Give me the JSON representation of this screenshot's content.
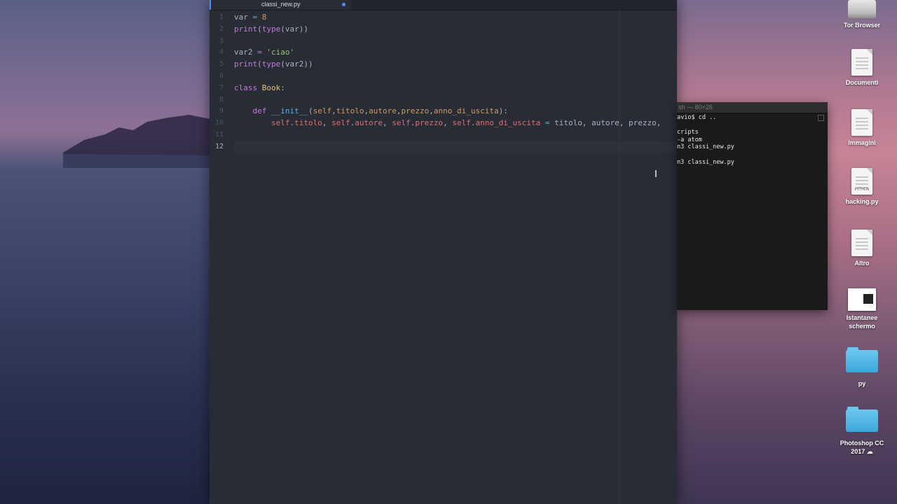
{
  "editor": {
    "tab_title": "classi_new.py",
    "line_numbers": [
      "1",
      "2",
      "3",
      "4",
      "5",
      "6",
      "7",
      "8",
      "9",
      "10",
      "11",
      "12"
    ],
    "lines": [
      [
        {
          "t": "var ",
          "c": ""
        },
        {
          "t": "=",
          "c": "op"
        },
        {
          "t": " ",
          "c": ""
        },
        {
          "t": "8",
          "c": "num"
        }
      ],
      [
        {
          "t": "print",
          "c": "kw"
        },
        {
          "t": "(",
          "c": ""
        },
        {
          "t": "type",
          "c": "kw"
        },
        {
          "t": "(var))",
          "c": ""
        }
      ],
      [],
      [
        {
          "t": "var2 ",
          "c": ""
        },
        {
          "t": "=",
          "c": "op"
        },
        {
          "t": " ",
          "c": ""
        },
        {
          "t": "'ciao'",
          "c": "str"
        }
      ],
      [
        {
          "t": "print",
          "c": "kw"
        },
        {
          "t": "(",
          "c": ""
        },
        {
          "t": "type",
          "c": "kw"
        },
        {
          "t": "(var2))",
          "c": ""
        }
      ],
      [],
      [
        {
          "t": "class",
          "c": "kw"
        },
        {
          "t": " ",
          "c": ""
        },
        {
          "t": "Book",
          "c": "cls"
        },
        {
          "t": ":",
          "c": ""
        }
      ],
      [],
      [
        {
          "t": "    ",
          "c": ""
        },
        {
          "t": "def",
          "c": "kw"
        },
        {
          "t": " ",
          "c": ""
        },
        {
          "t": "__init__",
          "c": "fn"
        },
        {
          "t": "(",
          "c": ""
        },
        {
          "t": "self",
          "c": "prm"
        },
        {
          "t": ",",
          "c": ""
        },
        {
          "t": "titolo",
          "c": "prm"
        },
        {
          "t": ",",
          "c": ""
        },
        {
          "t": "autore",
          "c": "prm"
        },
        {
          "t": ",",
          "c": ""
        },
        {
          "t": "prezzo",
          "c": "prm"
        },
        {
          "t": ",",
          "c": ""
        },
        {
          "t": "anno_di_uscita",
          "c": "prm"
        },
        {
          "t": "):",
          "c": ""
        }
      ],
      [
        {
          "t": "        ",
          "c": ""
        },
        {
          "t": "self",
          "c": "self"
        },
        {
          "t": ".",
          "c": ""
        },
        {
          "t": "titolo",
          "c": "self"
        },
        {
          "t": ", ",
          "c": ""
        },
        {
          "t": "self",
          "c": "self"
        },
        {
          "t": ".",
          "c": ""
        },
        {
          "t": "autore",
          "c": "self"
        },
        {
          "t": ", ",
          "c": ""
        },
        {
          "t": "self",
          "c": "self"
        },
        {
          "t": ".",
          "c": ""
        },
        {
          "t": "prezzo",
          "c": "self"
        },
        {
          "t": ", ",
          "c": ""
        },
        {
          "t": "self",
          "c": "self"
        },
        {
          "t": ".",
          "c": ""
        },
        {
          "t": "anno_di_uscita",
          "c": "self"
        },
        {
          "t": " ",
          "c": ""
        },
        {
          "t": "=",
          "c": "op"
        },
        {
          "t": " titolo, autore, prezzo,",
          "c": ""
        }
      ],
      [],
      []
    ]
  },
  "terminal": {
    "title": "sh — 80×26",
    "lines": [
      "avio$ cd ..",
      "",
      "cripts",
      "-a atom",
      "n3 classi_new.py",
      "",
      "n3 classi_new.py"
    ]
  },
  "desktop_icons": [
    {
      "label": "Tor Browser",
      "icon": "drive-icon"
    },
    {
      "label": "Documenti",
      "icon": "document-icon"
    },
    {
      "label": "Immagini",
      "icon": "jpeg-icon"
    },
    {
      "label": "hacking.py",
      "icon": "python-file-icon",
      "badge": "PYTHON"
    },
    {
      "label": "Altro",
      "icon": "document-icon"
    },
    {
      "label": "Istantanee schermo",
      "icon": "screenshot-icon"
    },
    {
      "label": "py",
      "icon": "folder-icon"
    },
    {
      "label": "Photoshop CC 2017 ☁",
      "icon": "folder-icon"
    }
  ],
  "colors": {
    "editor_bg": "#282c34",
    "accent": "#528bff",
    "keyword": "#c678dd",
    "function": "#61afef",
    "string": "#98c379",
    "number": "#d19a66",
    "class_name": "#e5c07b",
    "self_attr": "#e06c75"
  }
}
